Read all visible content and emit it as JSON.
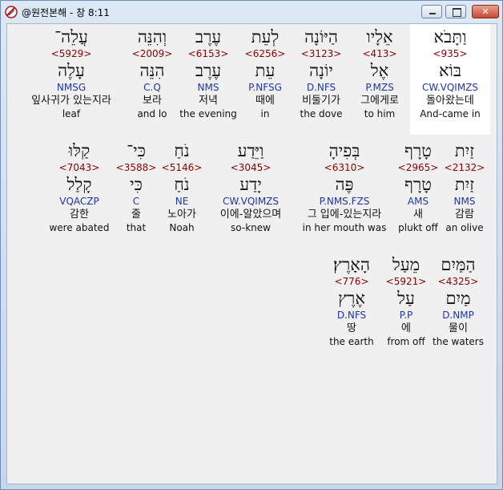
{
  "window": {
    "title": "@원전본해 - 창 8:11",
    "min_glyph": "",
    "max_glyph": "",
    "close_glyph": "✕"
  },
  "rows": [
    {
      "words": [
        {
          "heb": "וַתָּבֹא",
          "num": "<935>",
          "root": "בּוֹא",
          "parse": "CW.VQIMZS",
          "kor": "돌아왔는데",
          "eng": "And-came in",
          "selected": true
        },
        {
          "heb": "אֵלָיו",
          "num": "<413>",
          "root": "אֶל",
          "parse": "P.MZS",
          "kor": "그에게로",
          "eng": "to him"
        },
        {
          "heb": "הַיּוֹנָה",
          "num": "<3123>",
          "root": "יוֹנָה",
          "parse": "D.NFS",
          "kor": "비둘기가",
          "eng": "the dove"
        },
        {
          "heb": "לְעֵת",
          "num": "<6256>",
          "root": "עֵת",
          "parse": "P.NFSG",
          "kor": "때에",
          "eng": "in"
        },
        {
          "heb": "עֶרֶב",
          "num": "<6153>",
          "root": "עֶרֶב",
          "parse": "NMS",
          "kor": "저녁",
          "eng": "the evening"
        },
        {
          "heb": "וְהִנֵּה",
          "num": "<2009>",
          "root": "הִנֵּה",
          "parse": "C.Q",
          "kor": "보라",
          "eng": "and lo"
        },
        {
          "heb": "עֲלֵה־",
          "num": "<5929>",
          "root": "עָלֶה",
          "parse": "NMSG",
          "kor": "잎사귀가 있는지라",
          "eng": "leaf"
        }
      ]
    },
    {
      "words": [
        {
          "heb": "זַיִת",
          "num": "<2132>",
          "root": "זַיִת",
          "parse": "NMS",
          "kor": "감람",
          "eng": "an olive"
        },
        {
          "heb": "טָרָף",
          "num": "<2965>",
          "root": "טָרָף",
          "parse": "AMS",
          "kor": "새",
          "eng": "plukt off"
        },
        {
          "heb": "בְּפִיהָ",
          "num": "<6310>",
          "root": "פֶּה",
          "parse": "P.NMS.FZS",
          "kor": "그 입에-있는지라",
          "eng": "in her mouth was"
        },
        {
          "heb": "וַיֵּדַע",
          "num": "<3045>",
          "root": "יָדַע",
          "parse": "CW.VQIMZS",
          "kor": "이에-알았으며",
          "eng": "so-knew"
        },
        {
          "heb": "נֹחַ",
          "num": "<5146>",
          "root": "נֹחַ",
          "parse": "NE",
          "kor": "노아가",
          "eng": "Noah"
        },
        {
          "heb": "כִּי־",
          "num": "<3588>",
          "root": "כִּי",
          "parse": "C",
          "kor": "줄",
          "eng": "that"
        },
        {
          "heb": "קַלּוּ",
          "num": "<7043>",
          "root": "קָלַל",
          "parse": "VQACZP",
          "kor": "감한",
          "eng": "were abated"
        }
      ]
    },
    {
      "words": [
        {
          "heb": "הַמַּיִם",
          "num": "<4325>",
          "root": "מַיִם",
          "parse": "D.NMP",
          "kor": "물이",
          "eng": "the waters"
        },
        {
          "heb": "מֵעַל",
          "num": "<5921>",
          "root": "עַל",
          "parse": "P.P",
          "kor": "에",
          "eng": "from off"
        },
        {
          "heb": "הָאָרֶץ׃",
          "num": "<776>",
          "root": "אֶרֶץ",
          "parse": "D.NFS",
          "kor": "땅",
          "eng": "the earth"
        }
      ]
    }
  ]
}
